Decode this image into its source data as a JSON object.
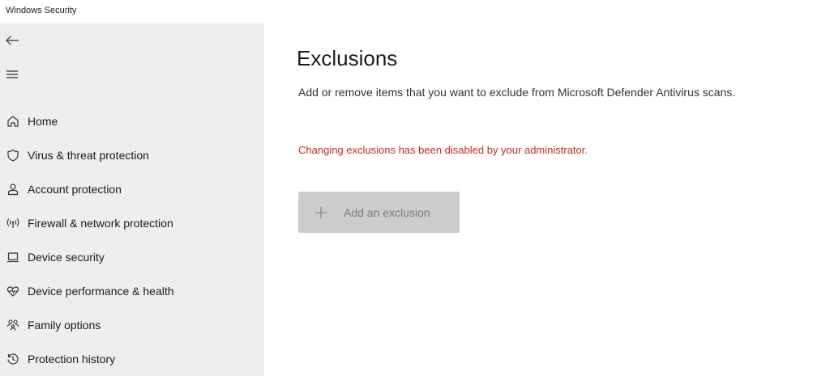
{
  "window": {
    "title": "Windows Security"
  },
  "sidebar": {
    "back_icon": "back-arrow-icon",
    "menu_icon": "hamburger-menu-icon",
    "items": [
      {
        "label": "Home",
        "icon": "home-icon"
      },
      {
        "label": "Virus & threat protection",
        "icon": "shield-icon"
      },
      {
        "label": "Account protection",
        "icon": "person-icon"
      },
      {
        "label": "Firewall & network protection",
        "icon": "wireless-antenna-icon"
      },
      {
        "label": "Device security",
        "icon": "laptop-icon"
      },
      {
        "label": "Device performance & health",
        "icon": "heart-pulse-icon"
      },
      {
        "label": "Family options",
        "icon": "family-icon"
      },
      {
        "label": "Protection history",
        "icon": "history-icon"
      }
    ]
  },
  "main": {
    "title": "Exclusions",
    "description": "Add or remove items that you want to exclude from Microsoft Defender Antivirus scans.",
    "warning": "Changing exclusions has been disabled by your administrator.",
    "add_button": {
      "label": "Add an exclusion",
      "icon": "plus-icon",
      "disabled": true
    }
  },
  "colors": {
    "sidebar_bg": "#eeeeee",
    "warning_text": "#c42b1c",
    "disabled_button_bg": "#cccccc",
    "disabled_button_text": "#7a7a7a"
  }
}
